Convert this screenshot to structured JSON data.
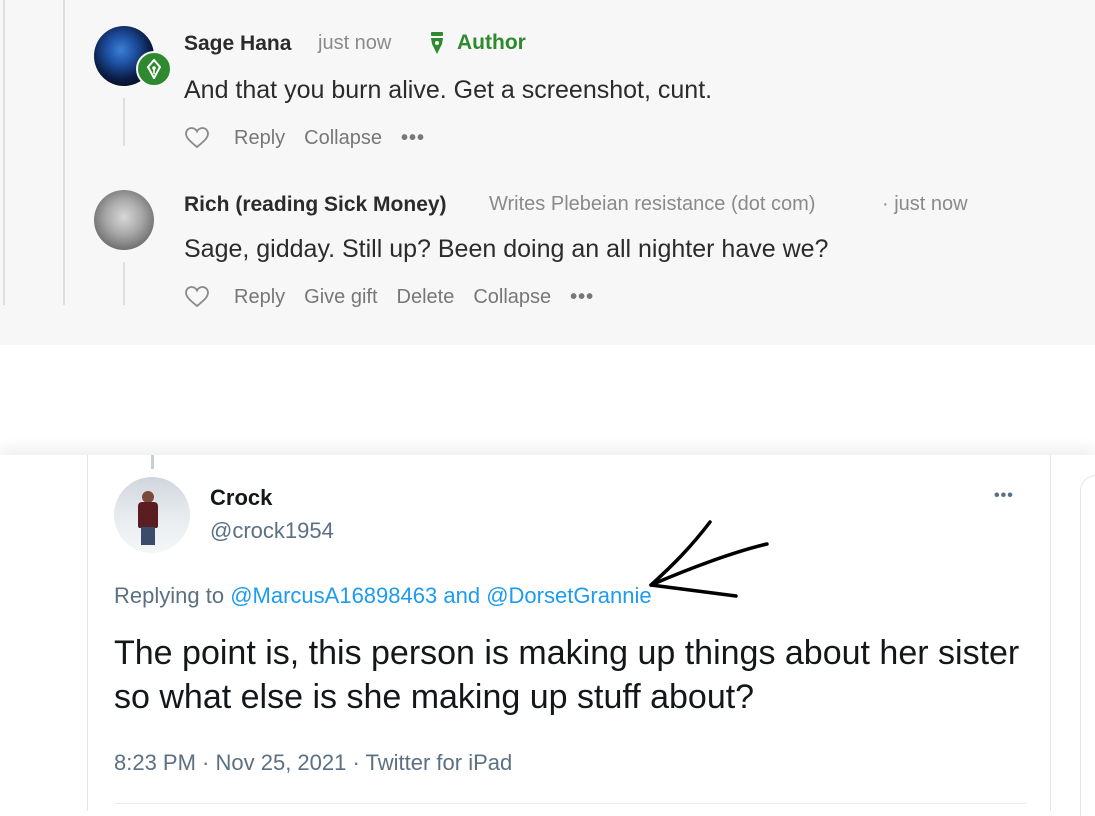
{
  "comments": [
    {
      "author": "Sage Hana",
      "timestamp": "just now",
      "badge": "Author",
      "badge_icon": "pen-nib-icon",
      "text": "And that you burn alive. Get a screenshot, cunt.",
      "actions": [
        "Reply",
        "Collapse"
      ]
    },
    {
      "author": "Rich (reading Sick Money)",
      "byline": "Writes Plebeian resistance (dot com)",
      "timestamp": "· just now",
      "text": "Sage, gidday. Still up? Been doing an all nighter have we?",
      "actions": [
        "Reply",
        "Give gift",
        "Delete",
        "Collapse"
      ]
    }
  ],
  "more_label": "•••",
  "tweet": {
    "name": "Crock",
    "handle": "@crock1954",
    "replying_prefix": "Replying to",
    "mention1": "@MarcusA16898463",
    "conjunction": "and",
    "mention2": "@DorsetGrannie",
    "text": "The point is, this person is making up things about her sister so what else is she making up stuff about?",
    "meta": "8:23 PM · Nov 25, 2021 · Twitter for iPad",
    "more_label": "•••"
  },
  "colors": {
    "author_green": "#2f8a2f",
    "mention_blue": "#1d9bf0",
    "panel_bg": "#f7f7f7"
  }
}
